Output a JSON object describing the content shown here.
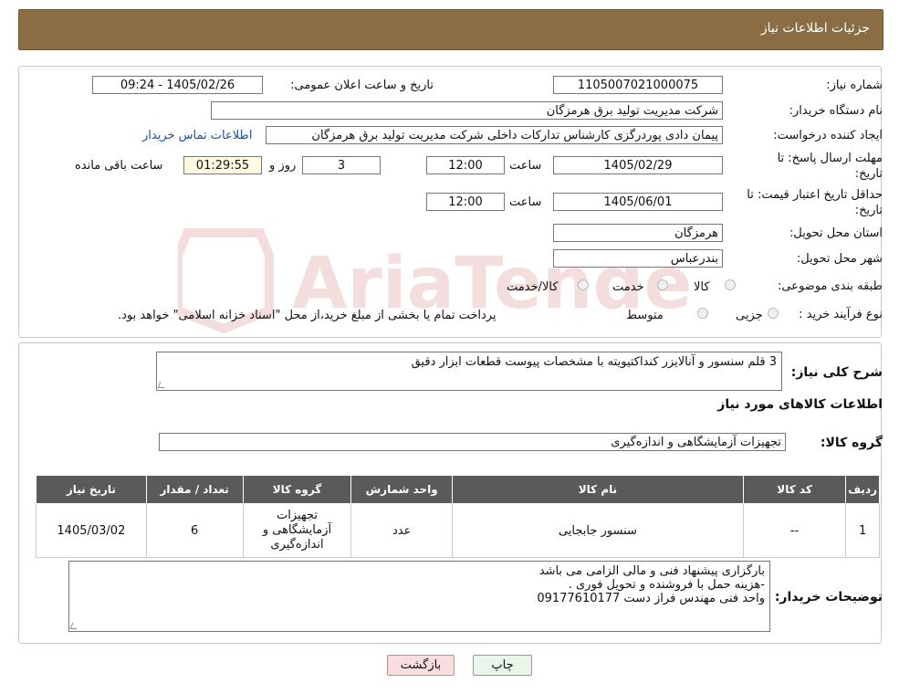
{
  "header": {
    "title": "جزئیات اطلاعات نیاز"
  },
  "form": {
    "need_number_label": "شماره نیاز:",
    "need_number": "1105007021000075",
    "announce_label": "تاریخ و ساعت اعلان عمومی:",
    "announce_value": "1405/02/26 - 09:24",
    "buyer_org_label": "نام دستگاه خریدار:",
    "buyer_org": "شرکت مدیریت تولید برق هرمزگان",
    "creator_label": "ایجاد کننده درخواست:",
    "creator": "پیمان دادی پوردرگزی کارشناس تدارکات داخلی شرکت مدیریت تولید برق هرمزگان",
    "contact_link": "اطلاعات تماس خریدار",
    "deadline_label_1": "مهلت ارسال پاسخ: تا",
    "deadline_label_2": "تاریخ:",
    "deadline_date": "1405/02/29",
    "time_label": "ساعت",
    "deadline_time": "12:00",
    "days_value": "3",
    "days_label": "روز و",
    "remaining_value": "01:29:55",
    "remaining_label": "ساعت باقی مانده",
    "validity_label_1": "حداقل تاریخ اعتبار قیمت: تا",
    "validity_label_2": "تاریخ:",
    "validity_date": "1405/06/01",
    "validity_time": "12:00",
    "province_label": "استان محل تحویل:",
    "province": "هرمزگان",
    "city_label": "شهر محل تحویل:",
    "city": "بندرعباس",
    "category_label": "طبقه بندی موضوعی:",
    "category_options": [
      "کالا",
      "خدمت",
      "کالا/خدمت"
    ],
    "process_label": "نوع فرآیند خرید :",
    "process_options": [
      "جزیی",
      "متوسط"
    ],
    "process_note": "پرداخت تمام یا بخشی از مبلغ خرید،از محل \"اسناد خزانه اسلامی\" خواهد بود."
  },
  "summary": {
    "label": "شرح کلی نیاز:",
    "text": "3 قلم سنسور و آنالایزر کنداکتیویته با مشخصات پیوست قطعات ابزار دقیق",
    "goods_info_title": "اطلاعات کالاهای مورد نیاز",
    "group_label": "گروه کالا:",
    "group_value": "تجهیزات آزمایشگاهی و اندازه‌گیری"
  },
  "table": {
    "headers": [
      "ردیف",
      "کد کالا",
      "نام کالا",
      "واحد شمارش",
      "گروه کالا",
      "تعداد / مقدار",
      "تاریخ نیاز"
    ],
    "rows": [
      [
        "1",
        "--",
        "سنسور جابجایی",
        "عدد",
        "تجهیزات آزمایشگاهی و اندازه‌گیری",
        "6",
        "1405/03/02"
      ]
    ]
  },
  "buyer_notes": {
    "label": "توضیحات خریدار:",
    "line1": "بارگزاری پیشنهاد فنی و مالی الزامی می باشد",
    "line2": "-هزینه حمل با فروشنده و تحویل فوری .",
    "line3": "واحد فنی مهندس فراز دست 09177610177"
  },
  "buttons": {
    "print": "چاپ",
    "back": "بازگشت"
  },
  "colors": {
    "header_bg": "#8b6d44",
    "table_header_bg": "#5a5a5a",
    "print_bg": "#eaf6ea",
    "back_bg": "#f8dede",
    "link": "#1a4fa8"
  }
}
